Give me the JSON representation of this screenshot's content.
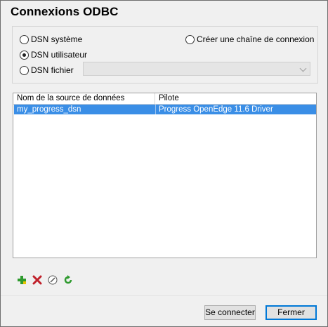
{
  "dialog": {
    "title": "Connexions ODBC"
  },
  "options": {
    "dsn_system": "DSN système",
    "dsn_user": "DSN utilisateur",
    "dsn_file": "DSN fichier",
    "connection_string": "Créer une chaîne de connexion",
    "selected": "dsn_user",
    "file_combo_value": ""
  },
  "list": {
    "columns": [
      "Nom de la source de données",
      "Pilote"
    ],
    "rows": [
      {
        "name": "my_progress_dsn",
        "driver": "Progress OpenEdge 11.6 Driver",
        "selected": true
      }
    ]
  },
  "toolbar": {
    "icons": [
      "add-icon",
      "delete-icon",
      "edit-icon",
      "refresh-icon"
    ]
  },
  "buttons": {
    "connect": "Se connecter",
    "close": "Fermer"
  },
  "colors": {
    "selection": "#3a8ee6",
    "add": "#2e9a2e",
    "delete": "#c0202a",
    "refresh": "#2e9a2e"
  }
}
